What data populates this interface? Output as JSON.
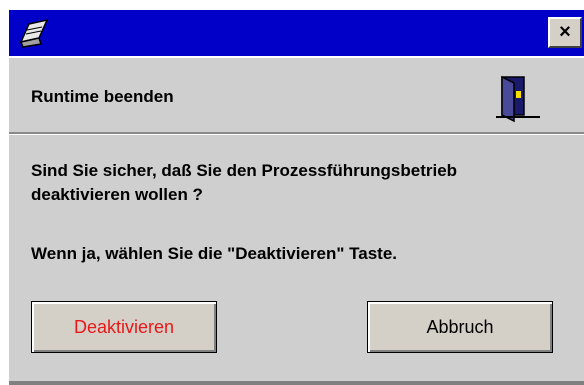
{
  "window": {
    "close_label": "×"
  },
  "header": {
    "title": "Runtime beenden"
  },
  "message": {
    "line1": "Sind Sie sicher, daß Sie den Prozessführungsbetrieb",
    "line2": "deaktivieren wollen ?",
    "line3": "Wenn ja, wählen Sie die \"Deaktivieren\" Taste."
  },
  "buttons": {
    "deactivate_label": "Deaktivieren",
    "cancel_label": "Abbruch"
  },
  "colors": {
    "titlebar": "#0000c8",
    "dialog_bg": "#cfcfcf",
    "deactivate_text": "#e81818"
  },
  "icons": {
    "title": "notepad-icon",
    "header": "exit-door-icon"
  }
}
